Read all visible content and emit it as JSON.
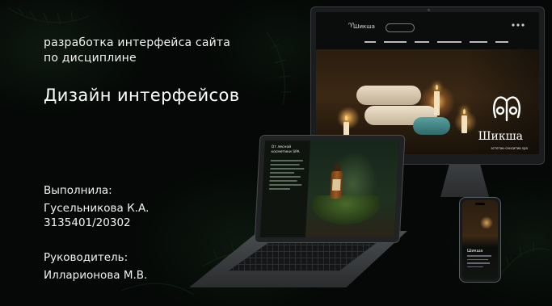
{
  "slide": {
    "subtitle_line1": "разработка интерфейса сайта",
    "subtitle_line2": "по дисциплине",
    "course_title": "Дизайн интерфейсов",
    "author_label": "Выполнила:",
    "author_name": "Гусельникова К.А.",
    "author_group": "3135401/20302",
    "supervisor_label": "Руководитель:",
    "supervisor_name": "Илларионова М.В."
  },
  "mockup": {
    "site_name": "Шикша",
    "hero_tagline": "эстетик-сенситив spa",
    "laptop_heading": "От лесной косметики SPA",
    "phone_heading": "Шикша"
  },
  "colors": {
    "background": "#050806",
    "text": "#ffffff",
    "candle_glow": "#ffd27a"
  }
}
